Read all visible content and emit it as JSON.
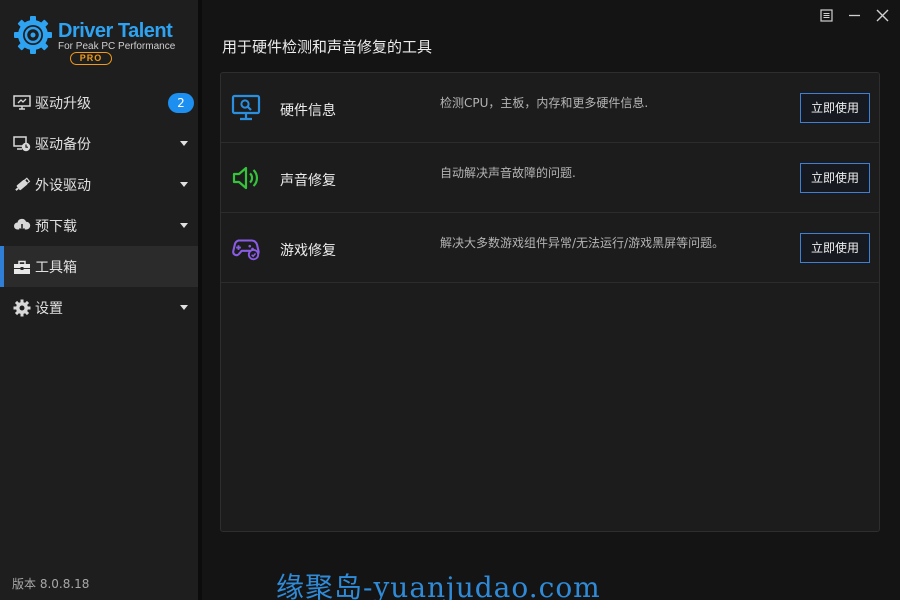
{
  "app": {
    "logo_name": "Driver Talent",
    "logo_tagline": "For Peak PC Performance",
    "logo_edition": "PRO",
    "version": "版本 8.0.8.18"
  },
  "sidebar": {
    "items": [
      {
        "label": "驱动升级",
        "icon": "monitor-upgrade-icon",
        "badge": "2"
      },
      {
        "label": "驱动备份",
        "icon": "backup-clock-icon"
      },
      {
        "label": "外设驱动",
        "icon": "usb-device-icon"
      },
      {
        "label": "预下载",
        "icon": "cloud-download-icon"
      },
      {
        "label": "工具箱",
        "icon": "toolbox-icon",
        "active": true
      },
      {
        "label": "设置",
        "icon": "gear-icon"
      }
    ]
  },
  "main": {
    "title": "用于硬件检测和声音修复的工具",
    "tools": [
      {
        "name": "硬件信息",
        "description": "检测CPU，主板，内存和更多硬件信息.",
        "button": "立即使用",
        "icon": "monitor-search-icon"
      },
      {
        "name": "声音修复",
        "description": "自动解决声音故障的问题.",
        "button": "立即使用",
        "icon": "speaker-icon"
      },
      {
        "name": "游戏修复",
        "description": "解决大多数游戏组件异常/无法运行/游戏黑屏等问题。",
        "button": "立即使用",
        "icon": "gamepad-icon"
      }
    ]
  },
  "watermark": "缘聚岛-yuanjudao.com",
  "colors": {
    "accent": "#1c8ff0",
    "button_border": "#3f7fd6",
    "sound_icon": "#36c23a",
    "game_icon": "#8a5ce6",
    "pro": "#f09a1a"
  }
}
